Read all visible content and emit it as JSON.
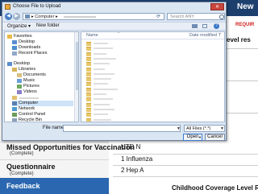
{
  "page": {
    "top_right_label": "New",
    "required_label": "REQUIR",
    "level_label": "evel res",
    "left_sections": [
      {
        "title": "Missed Opportunities for Vaccination",
        "status": "(Complete)"
      },
      {
        "title": "Questionnaire",
        "status": "(Complete)"
      }
    ],
    "feedback_label": "Feedback",
    "right_rows": [
      "UTD N",
      "1 Influenza",
      "2 Hep A"
    ],
    "coverage_label": "Childhood Coverage Level Re"
  },
  "dialog": {
    "title": "Choose File to Upload",
    "close_glyph": "✕",
    "address": {
      "prefix": "▸ Computer ▸"
    },
    "search_placeholder": "Search ANY",
    "toolbar": {
      "organize": "Organize ▾",
      "new_folder": "New folder"
    },
    "nav_items": [
      {
        "label": "Favorites",
        "icon": "star-icon",
        "indent": 0
      },
      {
        "label": "Desktop",
        "icon": "desktop-icon",
        "indent": 1
      },
      {
        "label": "Downloads",
        "icon": "downloads-icon",
        "indent": 1
      },
      {
        "label": "Recent Places",
        "icon": "recent-places-icon",
        "indent": 1
      },
      {
        "label": "Desktop",
        "icon": "desktop-icon",
        "indent": 0
      },
      {
        "label": "Libraries",
        "icon": "libraries-icon",
        "indent": 1
      },
      {
        "label": "Documents",
        "icon": "documents-icon",
        "indent": 2
      },
      {
        "label": "Music",
        "icon": "music-icon",
        "indent": 2
      },
      {
        "label": "Pictures",
        "icon": "pictures-icon",
        "indent": 2
      },
      {
        "label": "Videos",
        "icon": "videos-icon",
        "indent": 2
      },
      {
        "label": "",
        "icon": "user-folder-icon",
        "indent": 1
      },
      {
        "label": "Computer",
        "icon": "computer-icon",
        "indent": 1,
        "selected": true
      },
      {
        "label": "Network",
        "icon": "network-icon",
        "indent": 1
      },
      {
        "label": "Control Panel",
        "icon": "control-panel-icon",
        "indent": 1
      },
      {
        "label": "Recycle Bin",
        "icon": "recycle-bin-icon",
        "indent": 1
      }
    ],
    "columns": {
      "name": "Name",
      "date_modified": "Date modified",
      "type": "T"
    },
    "folder_count": 16,
    "file_name_label": "File name:",
    "file_type": "All Files (*.*)",
    "open_label": "Open",
    "cancel_label": "Cancel"
  }
}
